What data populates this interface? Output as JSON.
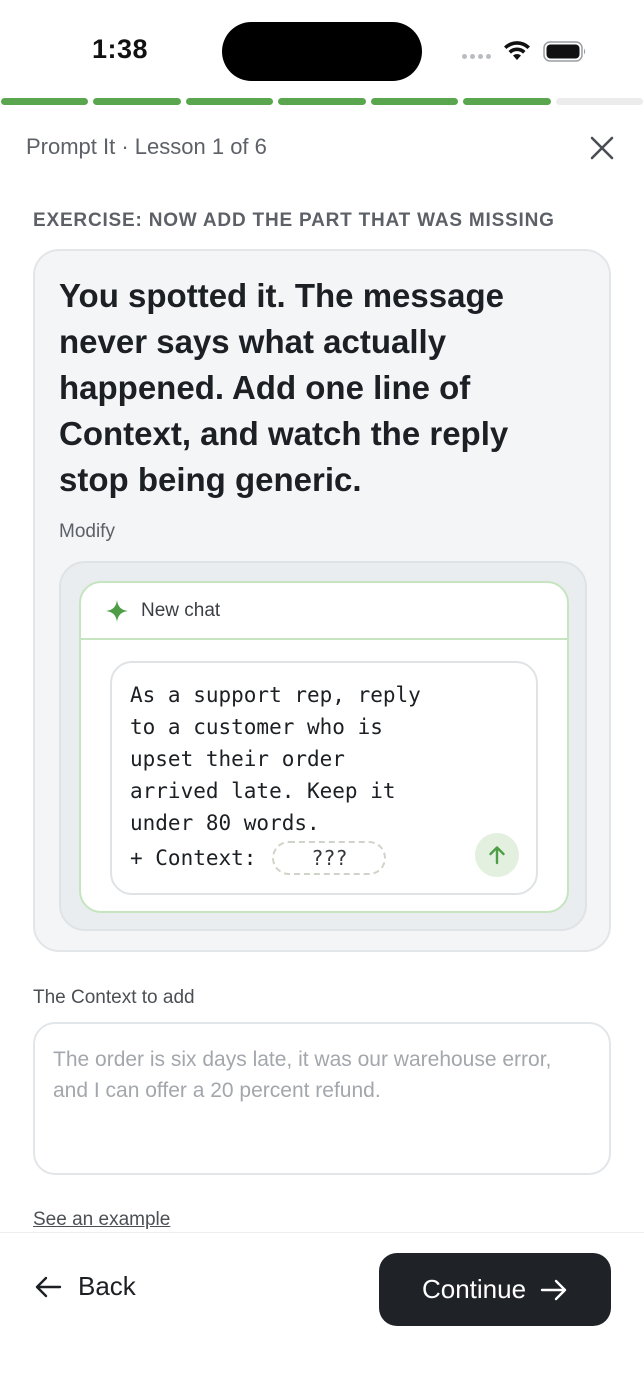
{
  "status_bar": {
    "time": "1:38"
  },
  "progress": {
    "total_steps": 7,
    "completed_steps": 6,
    "active_color": "#5aa64f"
  },
  "header": {
    "lesson_label": "Prompt It · Lesson 1 of 6",
    "close_icon": "close-icon"
  },
  "exercise": {
    "label": "EXERCISE: NOW ADD THE PART THAT WAS MISSING",
    "title": "You spotted it. The message never says what actually happened. Add one line of Context, and watch the reply stop being generic.",
    "modify_label": "Modify"
  },
  "chat": {
    "title": "New chat",
    "icon": "sparkle-icon",
    "prompt_text": "As a support rep, reply\nto a customer who is\nupset their order\narrived late. Keep it\nunder 80 words.",
    "context_prefix": "+ Context:",
    "context_slot": "???",
    "send_icon": "arrow-up-icon"
  },
  "context_input": {
    "label": "The Context to add",
    "placeholder": "The order is six days late, it was our warehouse error, and I can offer a 20 percent refund.",
    "value": ""
  },
  "links": {
    "see_example": "See an example"
  },
  "footer": {
    "back_label": "Back",
    "continue_label": "Continue"
  }
}
